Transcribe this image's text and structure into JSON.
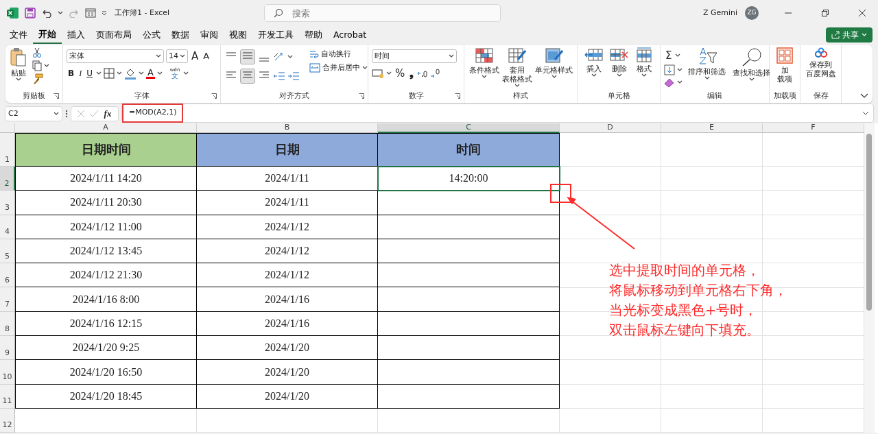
{
  "title_bar": {
    "title": "工作簿1  -  Excel",
    "search_placeholder": "搜索",
    "user_name": "Z Gemini",
    "avatar_initials": "ZG"
  },
  "menu_tabs": [
    {
      "label": "文件",
      "selected": false
    },
    {
      "label": "开始",
      "selected": true
    },
    {
      "label": "插入",
      "selected": false
    },
    {
      "label": "页面布局",
      "selected": false
    },
    {
      "label": "公式",
      "selected": false
    },
    {
      "label": "数据",
      "selected": false
    },
    {
      "label": "审阅",
      "selected": false
    },
    {
      "label": "视图",
      "selected": false
    },
    {
      "label": "开发工具",
      "selected": false
    },
    {
      "label": "帮助",
      "selected": false
    },
    {
      "label": "Acrobat",
      "selected": false
    }
  ],
  "share_button": "共享",
  "ribbon": {
    "clipboard": {
      "title": "剪贴板",
      "paste": "粘贴"
    },
    "font": {
      "title": "字体",
      "font_name": "宋体",
      "font_size": "14",
      "grow_glyph": "A",
      "shrink_glyph": "A",
      "bold": "B",
      "italic": "I",
      "underline": "U",
      "font_color_glyph": "A",
      "phonetic_top": "wén",
      "phonetic_bottom": "文"
    },
    "alignment": {
      "title": "对齐方式",
      "wrap_text": "自动换行",
      "merge_center": "合并后居中"
    },
    "number": {
      "title": "数字",
      "format": "时间",
      "percent": "%",
      "comma": "❟"
    },
    "styles": {
      "title": "样式",
      "buttons": [
        [
          "条件格式"
        ],
        [
          "套用",
          "表格格式"
        ],
        [
          "单元格样式"
        ]
      ]
    },
    "cells": {
      "title": "单元格",
      "buttons": [
        [
          "插入"
        ],
        [
          "删除"
        ],
        [
          "格式"
        ]
      ]
    },
    "editing": {
      "title": "编辑",
      "sum_glyph": "Σ",
      "buttons": [
        [
          "排序和筛选"
        ],
        [
          "查找和选择"
        ]
      ]
    },
    "addins": {
      "title": "加载项",
      "button": [
        "加",
        "载项"
      ]
    },
    "save": {
      "title": "保存",
      "button": [
        "保存到",
        "百度网盘"
      ]
    }
  },
  "formula_bar": {
    "name_box": "C2",
    "fx_label": "fx",
    "formula": "=MOD(A2,1)"
  },
  "sheet": {
    "columns": [
      {
        "label": "A",
        "selected": false
      },
      {
        "label": "B",
        "selected": false
      },
      {
        "label": "C",
        "selected": true
      },
      {
        "label": "D",
        "selected": false
      },
      {
        "label": "E",
        "selected": false
      },
      {
        "label": "F",
        "selected": false
      }
    ],
    "row_headers": [
      {
        "label": "1",
        "selected": false
      },
      {
        "label": "2",
        "selected": true
      },
      {
        "label": "3",
        "selected": false
      },
      {
        "label": "4",
        "selected": false
      },
      {
        "label": "5",
        "selected": false
      },
      {
        "label": "6",
        "selected": false
      },
      {
        "label": "7",
        "selected": false
      },
      {
        "label": "8",
        "selected": false
      },
      {
        "label": "9",
        "selected": false
      },
      {
        "label": "10",
        "selected": false
      },
      {
        "label": "11",
        "selected": false
      },
      {
        "label": "12",
        "selected": false
      }
    ],
    "header_cells": [
      {
        "text": "日期时间",
        "color": "#a9d08e"
      },
      {
        "text": "日期",
        "color": "#8eaadb"
      },
      {
        "text": "时间",
        "color": "#8eaadb"
      }
    ],
    "data_rows": [
      [
        {
          "text": "2024/1/11 14:20",
          "selected": false
        },
        {
          "text": "2024/1/11",
          "selected": false
        },
        {
          "text": "14:20:00",
          "selected": true
        }
      ],
      [
        {
          "text": "2024/1/11 20:30",
          "selected": false
        },
        {
          "text": "2024/1/11",
          "selected": false
        },
        {
          "text": "",
          "selected": false
        }
      ],
      [
        {
          "text": "2024/1/12 11:00",
          "selected": false
        },
        {
          "text": "2024/1/12",
          "selected": false
        },
        {
          "text": "",
          "selected": false
        }
      ],
      [
        {
          "text": "2024/1/12 13:45",
          "selected": false
        },
        {
          "text": "2024/1/12",
          "selected": false
        },
        {
          "text": "",
          "selected": false
        }
      ],
      [
        {
          "text": "2024/1/12 21:30",
          "selected": false
        },
        {
          "text": "2024/1/12",
          "selected": false
        },
        {
          "text": "",
          "selected": false
        }
      ],
      [
        {
          "text": "2024/1/16 8:00",
          "selected": false
        },
        {
          "text": "2024/1/16",
          "selected": false
        },
        {
          "text": "",
          "selected": false
        }
      ],
      [
        {
          "text": "2024/1/16 12:15",
          "selected": false
        },
        {
          "text": "2024/1/16",
          "selected": false
        },
        {
          "text": "",
          "selected": false
        }
      ],
      [
        {
          "text": "2024/1/20 9:25",
          "selected": false
        },
        {
          "text": "2024/1/20",
          "selected": false
        },
        {
          "text": "",
          "selected": false
        }
      ],
      [
        {
          "text": "2024/1/20 16:50",
          "selected": false
        },
        {
          "text": "2024/1/20",
          "selected": false
        },
        {
          "text": "",
          "selected": false
        }
      ],
      [
        {
          "text": "2024/1/20 18:45",
          "selected": false
        },
        {
          "text": "2024/1/20",
          "selected": false
        },
        {
          "text": "",
          "selected": false
        }
      ]
    ]
  },
  "annotation": {
    "lines": [
      "选中提取时间的单元格，",
      "将鼠标移动到单元格右下角，",
      "当光标变成黑色+号时，",
      "双击鼠标左键向下填充。"
    ]
  }
}
